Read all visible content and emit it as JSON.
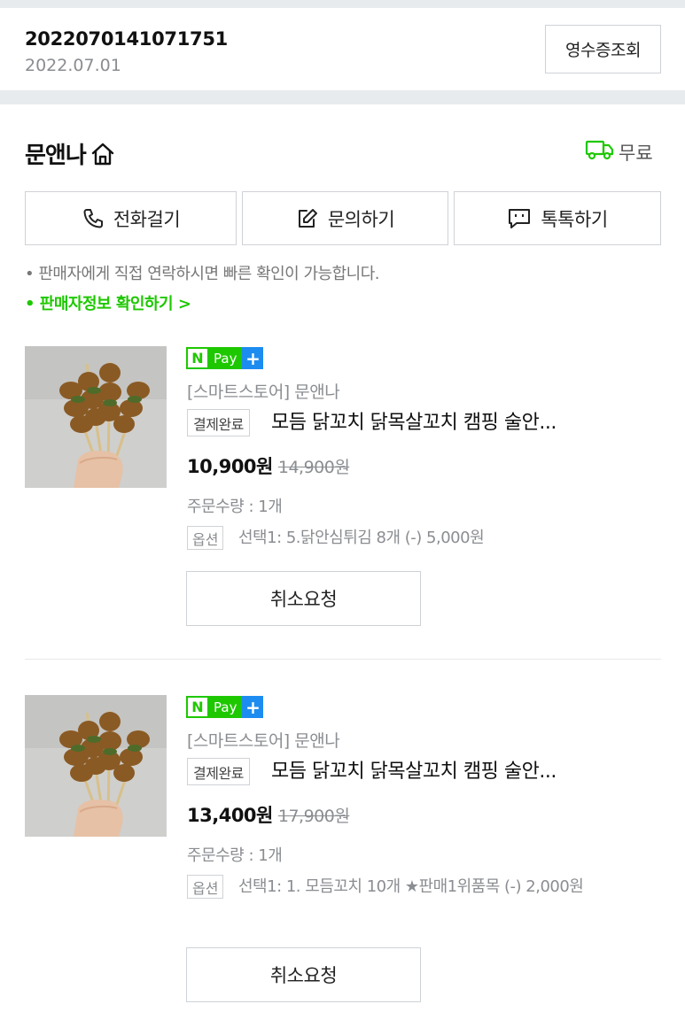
{
  "order": {
    "number": "2022070141071751",
    "date": "2022.07.01",
    "receipt_label": "영수증조회"
  },
  "store": {
    "name": "문앤나",
    "shipping_label": "무료"
  },
  "contact": {
    "call_label": "전화걸기",
    "inquiry_label": "문의하기",
    "talk_label": "톡톡하기"
  },
  "notice": "• 판매자에게 직접 연락하시면 빠른 확인이 가능합니다.",
  "seller_info_link": "• 판매자정보 확인하기 >",
  "items": [
    {
      "npay_n": "N",
      "npay_pay": "Pay",
      "npay_plus": "+",
      "store_line": "[스마트스토어] 문앤나",
      "status": "결제완료",
      "name": "모듬 닭꼬치 닭목살꼬치 캠핑 술안...",
      "price": "10,900원",
      "original_price": "14,900원",
      "quantity": "주문수량 : 1개",
      "option_label": "옵션",
      "option": "선택1: 5.닭안심튀김 8개 (-) 5,000원",
      "cancel_label": "취소요청"
    },
    {
      "npay_n": "N",
      "npay_pay": "Pay",
      "npay_plus": "+",
      "store_line": "[스마트스토어] 문앤나",
      "status": "결제완료",
      "name": "모듬 닭꼬치 닭목살꼬치 캠핑 술안...",
      "price": "13,400원",
      "original_price": "17,900원",
      "quantity": "주문수량 : 1개",
      "option_label": "옵션",
      "option": "선택1: 1. 모듬꼬치 10개 ★판매1위품목 (-) 2,000원",
      "cancel_label": "취소요청"
    }
  ],
  "colors": {
    "accent_green": "#1ec800",
    "npay_blue": "#1d8cf0",
    "section_gray": "#e8ebee"
  }
}
